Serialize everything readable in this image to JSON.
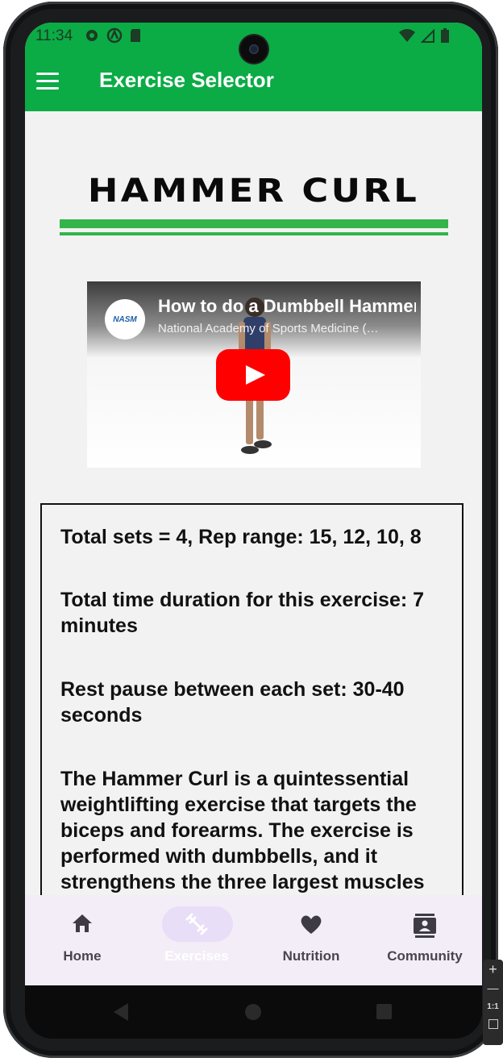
{
  "status_bar": {
    "time": "11:34",
    "left_icons": [
      "gear-icon",
      "a-icon",
      "sd-card-icon"
    ],
    "right_icons": [
      "wifi-icon",
      "signal-icon",
      "battery-icon"
    ]
  },
  "app_bar": {
    "menu_icon": "menu-icon",
    "title": "Exercise Selector",
    "color": "#0bab45"
  },
  "exercise": {
    "title": "HAMMER CURL",
    "accent": "#33b54a"
  },
  "video": {
    "channel_logo_text": "NASM",
    "title": "How to do a Dumbbell Hammer Curl",
    "channel": "National Academy of Sports Medicine (…",
    "play_icon": "play-icon"
  },
  "info": {
    "sets": "Total sets = 4, Rep range: 15, 12, 10, 8",
    "duration": "Total time duration for this exercise: 7 minutes",
    "rest": "Rest pause between each set: 30-40 seconds",
    "description": "The Hammer Curl is a quintessential weightlifting exercise that targets the biceps and forearms. The exercise is performed with dumbbells, and it strengthens the three largest muscles"
  },
  "bottom_nav": {
    "items": [
      {
        "label": "Home",
        "icon": "home-icon",
        "active": false
      },
      {
        "label": "Exercises",
        "icon": "dumbbell-icon",
        "active": true
      },
      {
        "label": "Nutrition",
        "icon": "heart-icon",
        "active": false
      },
      {
        "label": "Community",
        "icon": "contacts-icon",
        "active": false
      }
    ]
  },
  "emulator_toolbar": {
    "zoom_label": "1:1"
  }
}
